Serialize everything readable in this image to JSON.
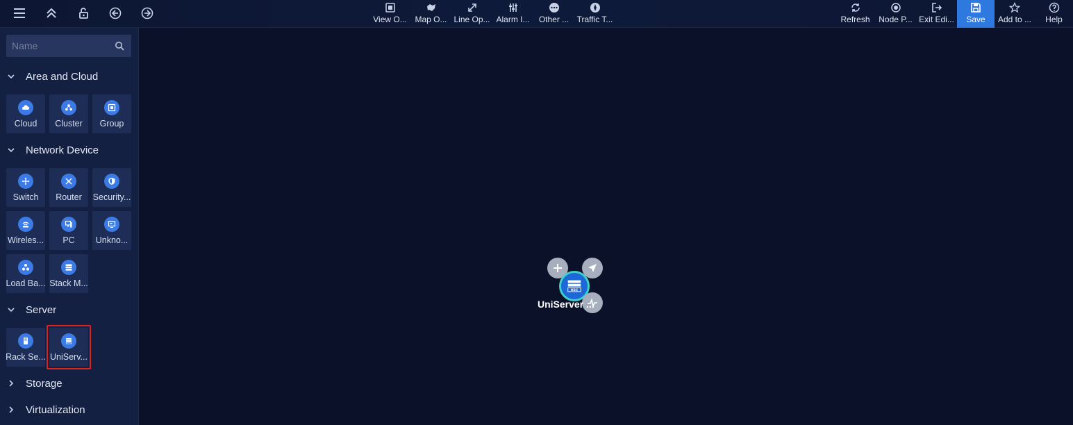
{
  "toolbar": {
    "center": [
      {
        "label": "View O...",
        "icon": "view-options-icon"
      },
      {
        "label": "Map O...",
        "icon": "map-options-icon"
      },
      {
        "label": "Line Op...",
        "icon": "line-options-icon"
      },
      {
        "label": "Alarm I...",
        "icon": "alarm-icon"
      },
      {
        "label": "Other ...",
        "icon": "other-icon"
      },
      {
        "label": "Traffic T...",
        "icon": "traffic-icon"
      }
    ],
    "right": [
      {
        "label": "Refresh",
        "icon": "refresh-icon"
      },
      {
        "label": "Node P...",
        "icon": "node-position-icon"
      },
      {
        "label": "Exit Edi...",
        "icon": "exit-icon"
      },
      {
        "label": "Save",
        "icon": "save-icon"
      },
      {
        "label": "Add to ...",
        "icon": "star-icon"
      },
      {
        "label": "Help",
        "icon": "help-icon"
      }
    ],
    "accent": "#2e79df"
  },
  "sidebar": {
    "search_placeholder": "Name",
    "sections": [
      {
        "title": "Area and Cloud",
        "expanded": true,
        "items": [
          "Cloud",
          "Cluster",
          "Group"
        ]
      },
      {
        "title": "Network Device",
        "expanded": true,
        "items": [
          "Switch",
          "Router",
          "Security...",
          "Wireles...",
          "PC",
          "Unkno...",
          "Load Ba...",
          "Stack M..."
        ]
      },
      {
        "title": "Server",
        "expanded": true,
        "items": [
          "Rack Se...",
          "UniServ..."
        ]
      },
      {
        "title": "Storage",
        "expanded": false
      },
      {
        "title": "Virtualization",
        "expanded": false
      }
    ]
  },
  "canvas": {
    "node": {
      "label": "UniServer ...",
      "badge": "H3C",
      "icon": "uniserver-icon"
    }
  }
}
